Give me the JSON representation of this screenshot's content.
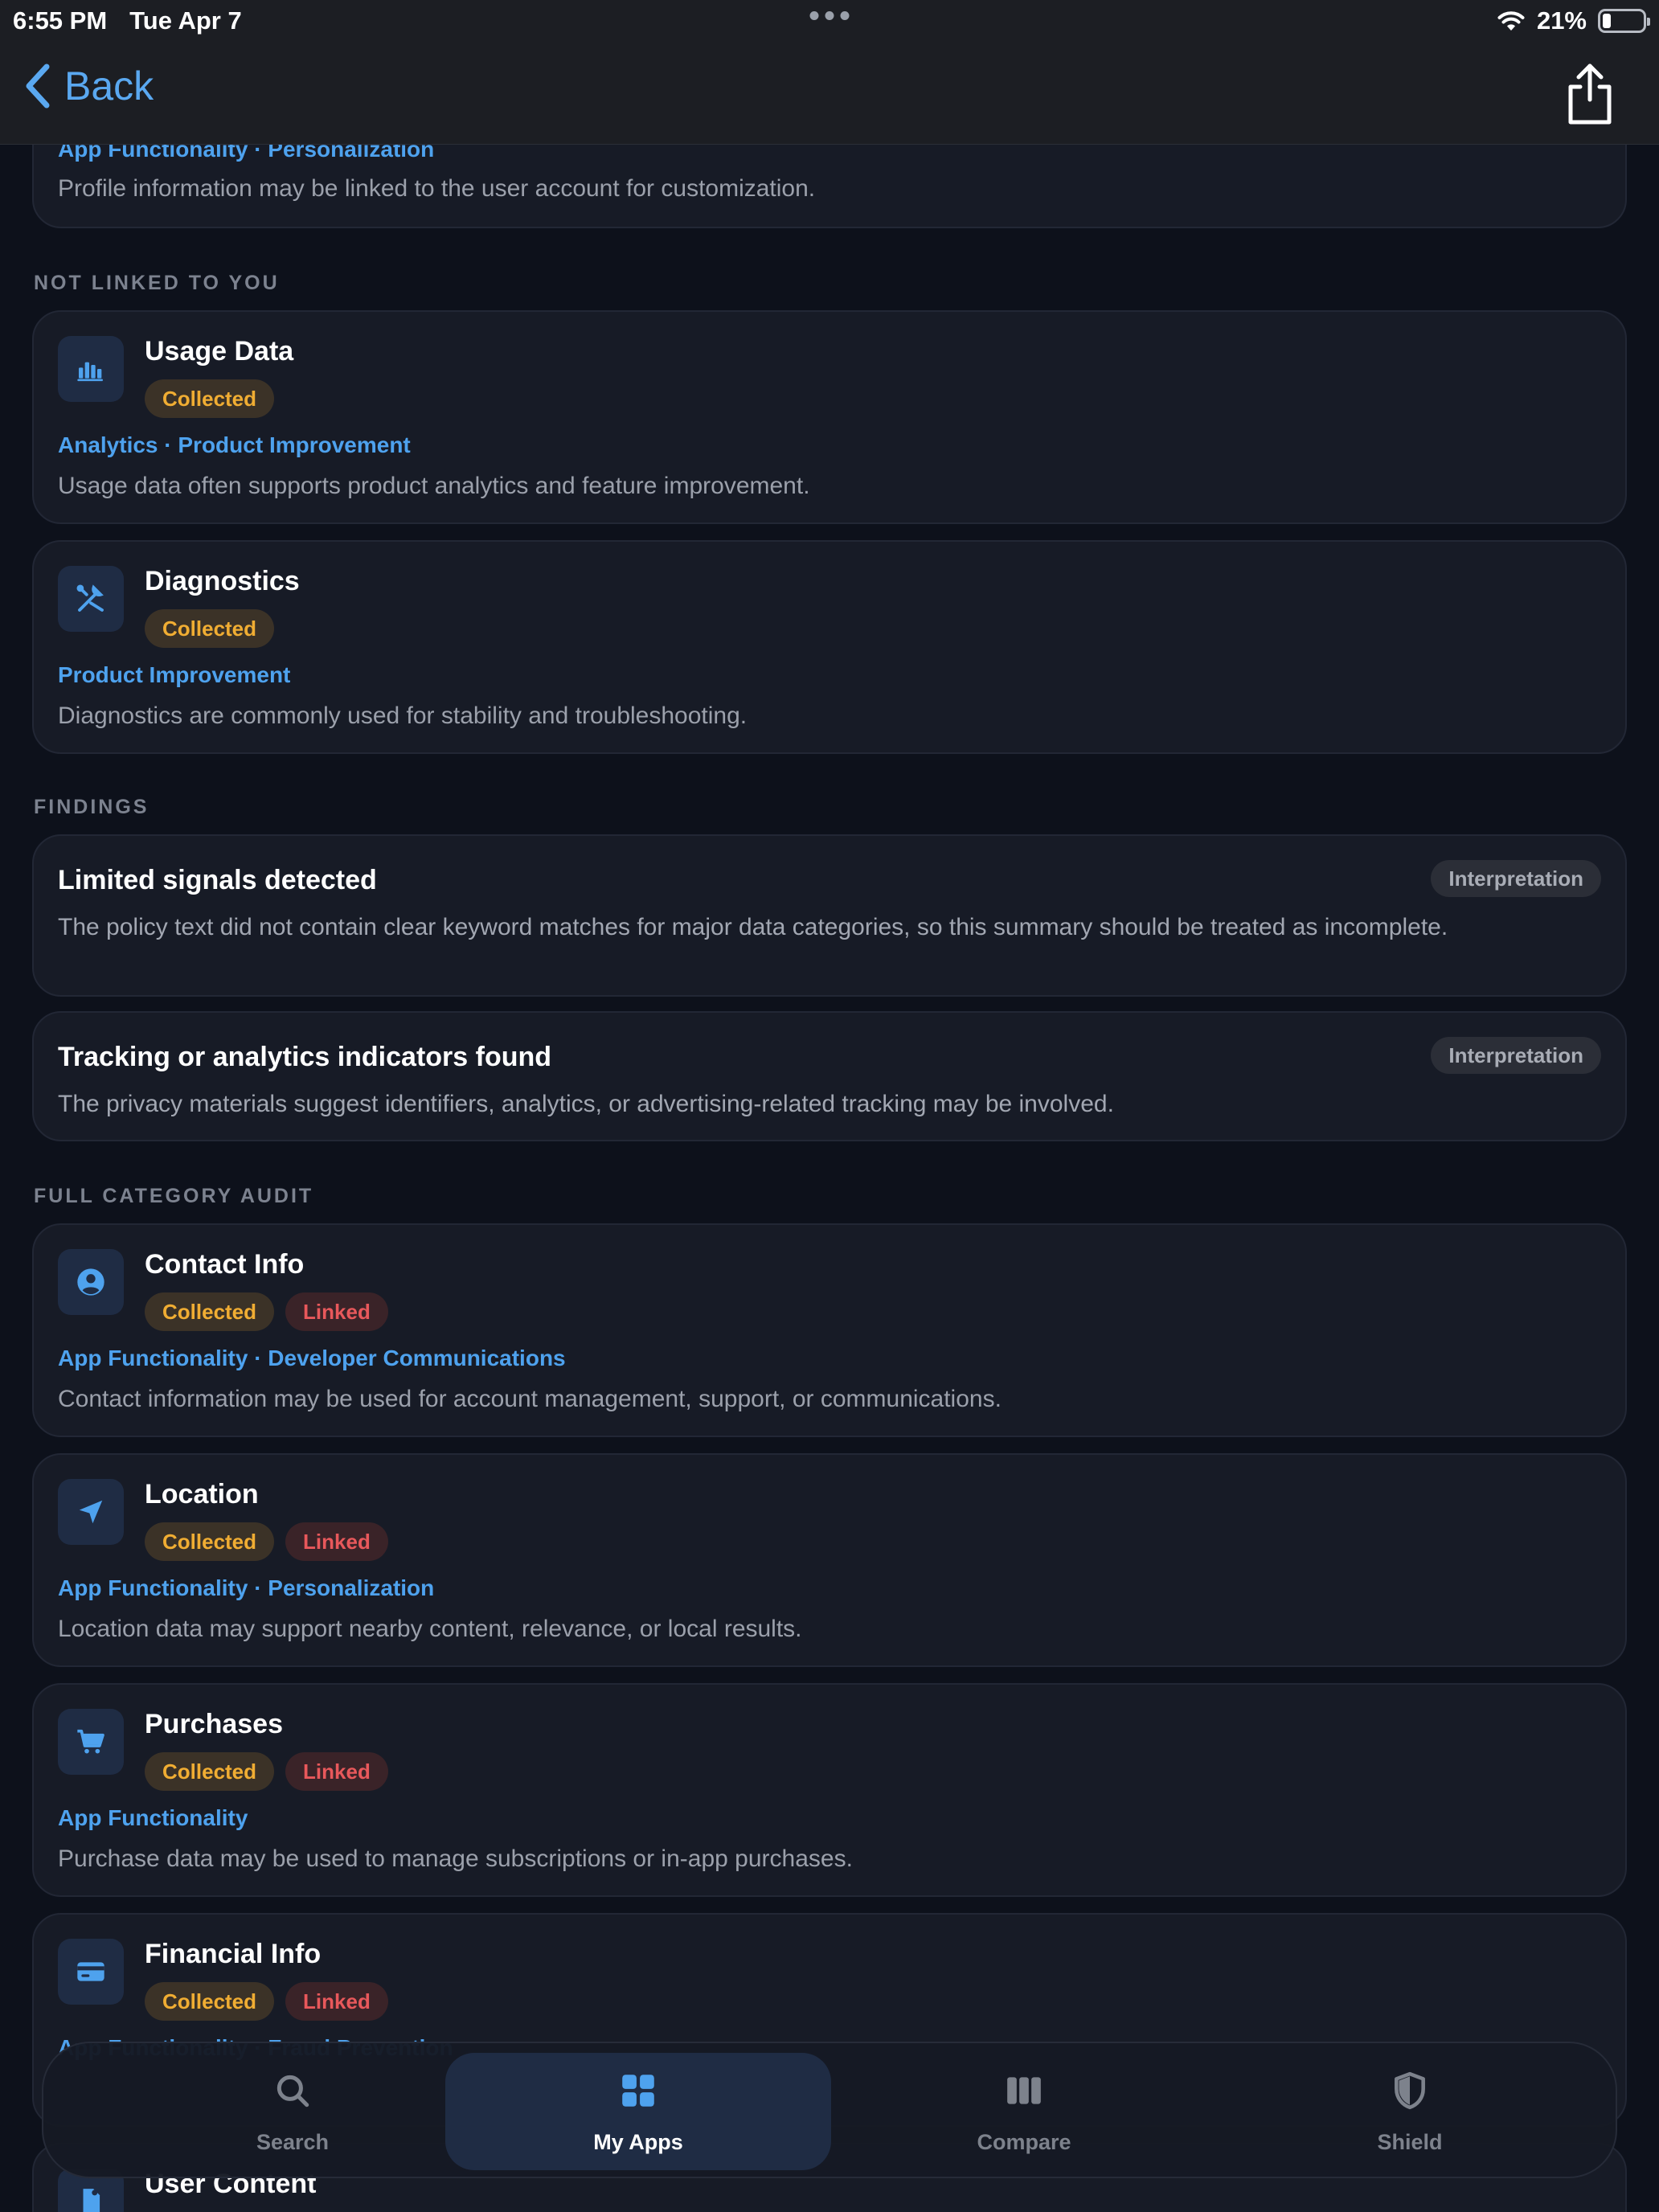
{
  "status_bar": {
    "time": "6:55 PM",
    "date": "Tue Apr 7",
    "battery": "21%",
    "battery_level": 0.21
  },
  "nav": {
    "back_label": "Back"
  },
  "top_partial": {
    "purposes": "App Functionality · Personalization",
    "description": "Profile information may be linked to the user account for customization."
  },
  "sections": {
    "not_linked": "NOT LINKED TO YOU",
    "findings": "FINDINGS",
    "full_audit": "FULL CATEGORY AUDIT"
  },
  "not_linked_items": [
    {
      "title": "Usage Data",
      "icon": "bar-chart-icon",
      "collected": "Collected",
      "purposes": "Analytics · Product Improvement",
      "description": "Usage data often supports product analytics and feature improvement."
    },
    {
      "title": "Diagnostics",
      "icon": "tools-icon",
      "collected": "Collected",
      "purposes": "Product Improvement",
      "description": "Diagnostics are commonly used for stability and troubleshooting."
    }
  ],
  "findings": [
    {
      "title": "Limited signals detected",
      "badge": "Interpretation",
      "body": "The policy text did not contain clear keyword matches for major data categories, so this summary should be treated as incomplete."
    },
    {
      "title": "Tracking or analytics indicators found",
      "badge": "Interpretation",
      "body": "The privacy materials suggest identifiers, analytics, or advertising-related tracking may be involved."
    }
  ],
  "audit_items": [
    {
      "title": "Contact Info",
      "icon": "person-circle-icon",
      "collected": "Collected",
      "linked": "Linked",
      "purposes": "App Functionality · Developer Communications",
      "description": "Contact information may be used for account management, support, or communications."
    },
    {
      "title": "Location",
      "icon": "location-arrow-icon",
      "collected": "Collected",
      "linked": "Linked",
      "purposes": "App Functionality · Personalization",
      "description": "Location data may support nearby content, relevance, or local results."
    },
    {
      "title": "Purchases",
      "icon": "cart-icon",
      "collected": "Collected",
      "linked": "Linked",
      "purposes": "App Functionality",
      "description": "Purchase data may be used to manage subscriptions or in-app purchases."
    },
    {
      "title": "Financial Info",
      "icon": "credit-card-icon",
      "collected": "Collected",
      "linked": "Linked",
      "purposes": "App Functionality · Fraud Prevention",
      "description": ""
    },
    {
      "title": "User Content",
      "icon": "document-icon"
    }
  ],
  "tabs": [
    {
      "label": "Search",
      "icon": "search-icon"
    },
    {
      "label": "My Apps",
      "icon": "grid-icon"
    },
    {
      "label": "Compare",
      "icon": "columns-icon"
    },
    {
      "label": "Shield",
      "icon": "shield-icon"
    }
  ],
  "colors": {
    "background": "#0d111b",
    "card": "#171b26",
    "accent": "#4ea2ee",
    "collected": "#f0ad33",
    "linked": "#e8585b"
  }
}
